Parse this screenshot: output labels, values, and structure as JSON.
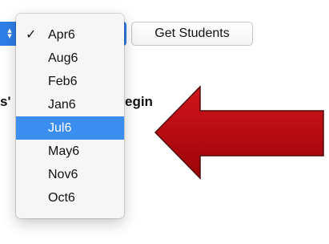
{
  "form": {
    "select_icon": "chevron-up-down-icon",
    "get_students_label": "Get Students",
    "left_label_fragment": "s'",
    "right_label_fragment": "egin"
  },
  "dropdown": {
    "check_icon": "✓",
    "options": [
      {
        "label": "Apr6",
        "checked": true
      },
      {
        "label": "Aug6"
      },
      {
        "label": "Feb6"
      },
      {
        "label": "Jan6"
      },
      {
        "label": "Jul6",
        "highlighted": true
      },
      {
        "label": "May6"
      },
      {
        "label": "Nov6"
      },
      {
        "label": "Oct6"
      }
    ]
  },
  "colors": {
    "arrow_fill": "#b3060c",
    "arrow_stroke": "#4d0a0a",
    "highlight": "#3b8ef0",
    "select_blue": "#2f7ee8"
  }
}
